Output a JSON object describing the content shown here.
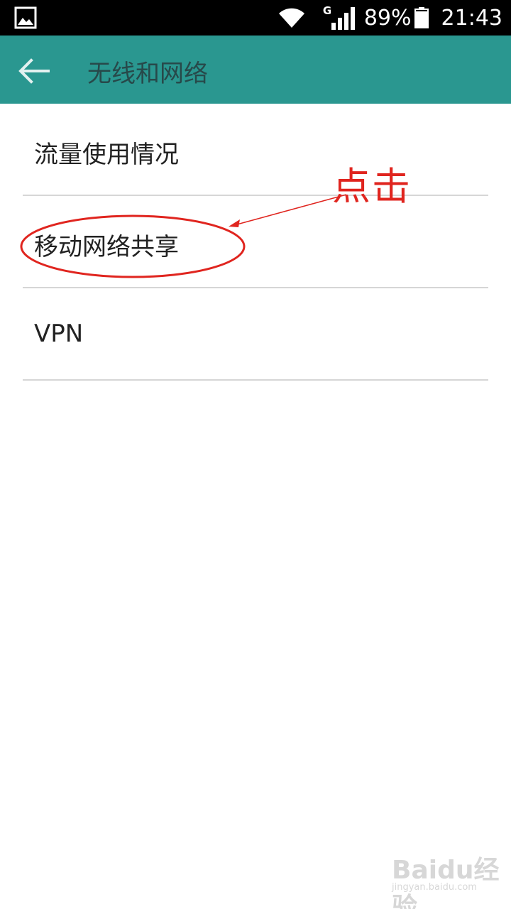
{
  "status_bar": {
    "network_type": "G",
    "battery_percent": "89%",
    "time": "21:43",
    "icons": [
      "gallery-icon",
      "wifi-icon",
      "cell-signal-icon",
      "battery-icon"
    ]
  },
  "toolbar": {
    "title": "无线和网络",
    "back_icon": "arrow-left-icon",
    "background_color": "#2a9790",
    "title_color": "#27494a"
  },
  "list": {
    "items": [
      {
        "label": "流量使用情况"
      },
      {
        "label": "移动网络共享"
      },
      {
        "label": "VPN"
      }
    ]
  },
  "annotation": {
    "text": "点击",
    "color": "#e0251f"
  },
  "watermark": {
    "brand": "Baidu经验",
    "url": "jingyan.baidu.com"
  }
}
